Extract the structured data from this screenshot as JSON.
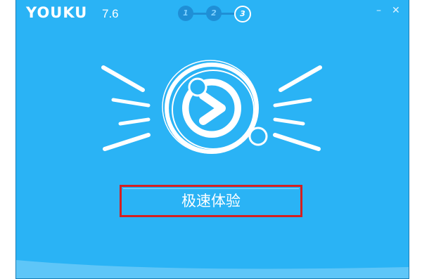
{
  "app": {
    "logo_text": "YOUKU",
    "version": "7.6"
  },
  "steps": [
    "1",
    "2",
    "3"
  ],
  "active_step": 3,
  "window_controls": {
    "minimize": "–",
    "close": "✕"
  },
  "hero": {
    "icon": "youku-play-logo-icon"
  },
  "cta": {
    "label": "极速体验"
  },
  "colors": {
    "background": "#2ab3f5",
    "step_inactive": "#1f8fd6",
    "highlight_border": "#d42020",
    "text": "#ffffff"
  }
}
